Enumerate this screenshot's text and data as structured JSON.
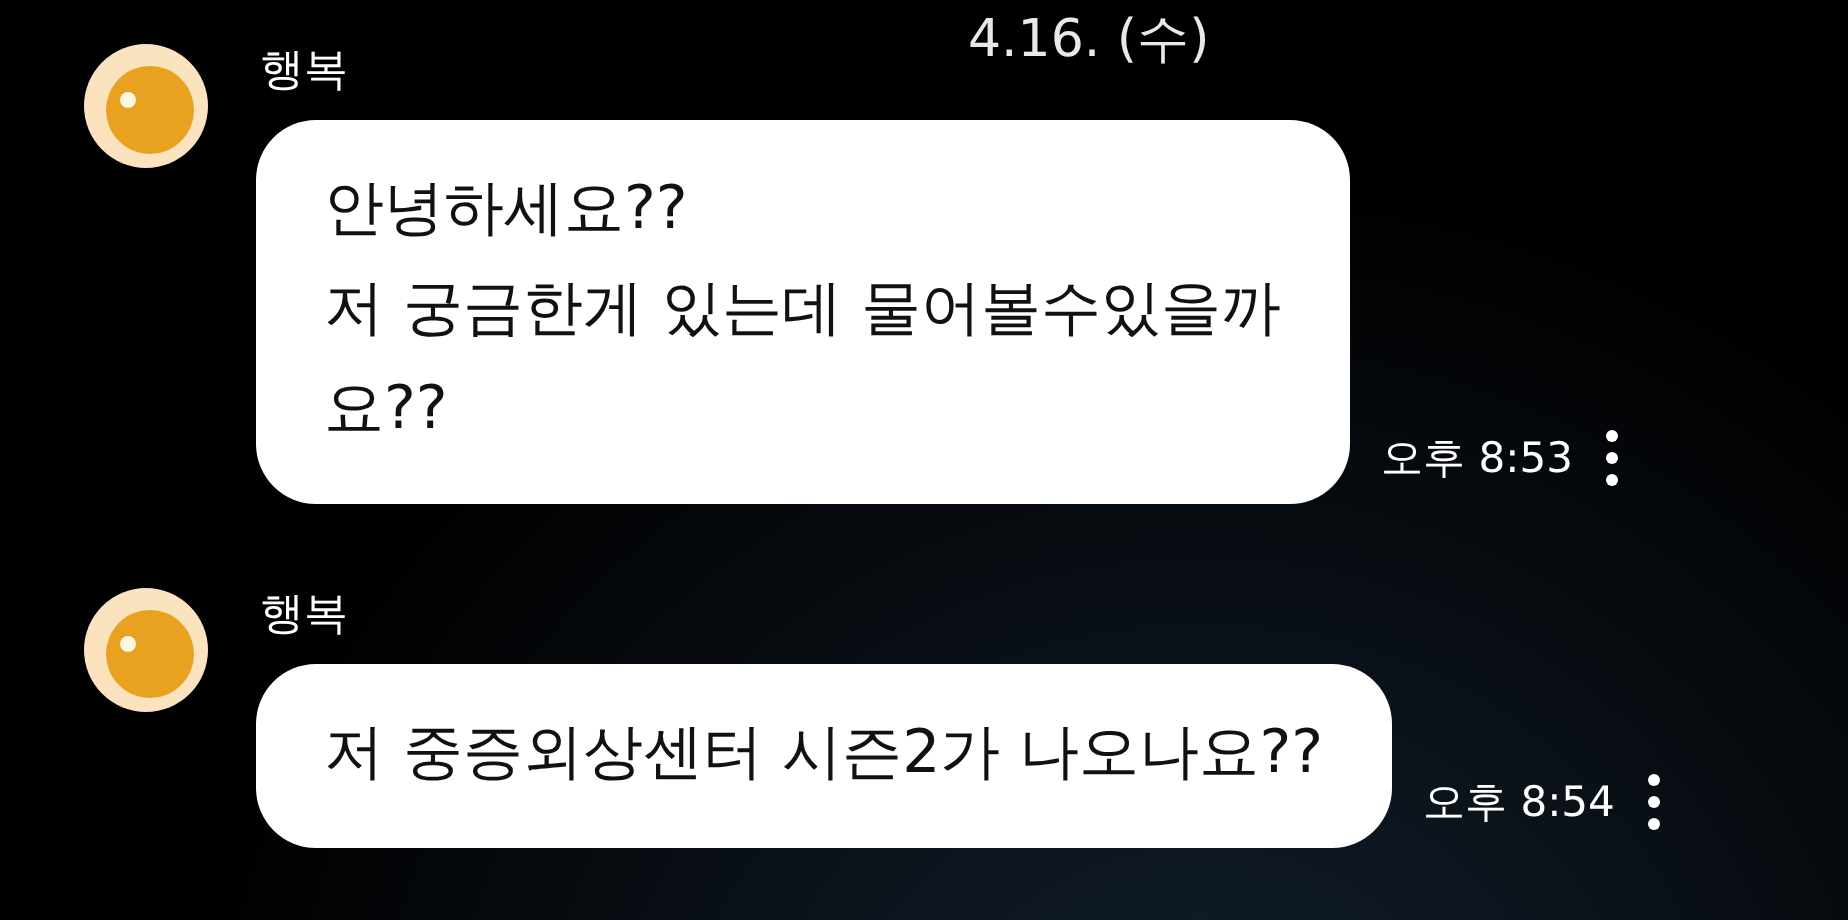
{
  "date_divider": "4.16. (수)",
  "messages": [
    {
      "sender": "행복",
      "text": "안녕하세요??\n저 궁금한게 있는데 물어볼수있을까\n요??",
      "time": "오후 8:53"
    },
    {
      "sender": "행복",
      "text": "저 중증외상센터 시즌2가 나오나요??",
      "time": "오후 8:54"
    }
  ]
}
